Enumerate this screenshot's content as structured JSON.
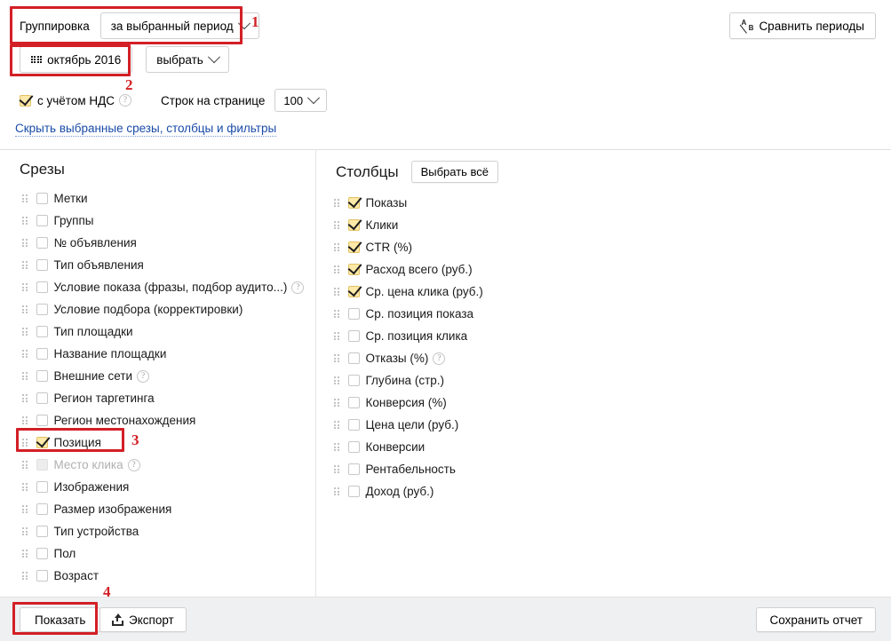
{
  "header": {
    "grouping_label": "Группировка",
    "grouping_value": "за выбранный период",
    "date_value": "октябрь 2016",
    "date_picker_label": "выбрать",
    "vat_label": "с учётом НДС",
    "vat_checked": true,
    "rows_per_page_label": "Строк на странице",
    "rows_per_page_value": "100",
    "toggle_link": "Скрыть выбранные срезы, столбцы и фильтры",
    "compare_periods_label": "Сравнить периоды",
    "compare_icon": "ab-test-icon",
    "calendar_icon": "calendar-icon"
  },
  "slices": {
    "title": "Срезы",
    "items": [
      {
        "label": "Метки",
        "checked": false,
        "disabled": false,
        "help": false
      },
      {
        "label": "Группы",
        "checked": false,
        "disabled": false,
        "help": false
      },
      {
        "label": "№ объявления",
        "checked": false,
        "disabled": false,
        "help": false
      },
      {
        "label": "Тип объявления",
        "checked": false,
        "disabled": false,
        "help": false
      },
      {
        "label": "Условие показа (фразы, подбор аудито...)",
        "checked": false,
        "disabled": false,
        "help": true
      },
      {
        "label": "Условие подбора (корректировки)",
        "checked": false,
        "disabled": false,
        "help": false
      },
      {
        "label": "Тип площадки",
        "checked": false,
        "disabled": false,
        "help": false
      },
      {
        "label": "Название площадки",
        "checked": false,
        "disabled": false,
        "help": false
      },
      {
        "label": "Внешние сети",
        "checked": false,
        "disabled": false,
        "help": true
      },
      {
        "label": "Регион таргетинга",
        "checked": false,
        "disabled": false,
        "help": false
      },
      {
        "label": "Регион местонахождения",
        "checked": false,
        "disabled": false,
        "help": false
      },
      {
        "label": "Позиция",
        "checked": true,
        "disabled": false,
        "help": false
      },
      {
        "label": "Место клика",
        "checked": false,
        "disabled": true,
        "help": true
      },
      {
        "label": "Изображения",
        "checked": false,
        "disabled": false,
        "help": false
      },
      {
        "label": "Размер изображения",
        "checked": false,
        "disabled": false,
        "help": false
      },
      {
        "label": "Тип устройства",
        "checked": false,
        "disabled": false,
        "help": false
      },
      {
        "label": "Пол",
        "checked": false,
        "disabled": false,
        "help": false
      },
      {
        "label": "Возраст",
        "checked": false,
        "disabled": false,
        "help": false
      }
    ]
  },
  "columns": {
    "title": "Столбцы",
    "select_all_label": "Выбрать всё",
    "items": [
      {
        "label": "Показы",
        "checked": true,
        "disabled": false,
        "help": false
      },
      {
        "label": "Клики",
        "checked": true,
        "disabled": false,
        "help": false
      },
      {
        "label": "CTR (%)",
        "checked": true,
        "disabled": false,
        "help": false
      },
      {
        "label": "Расход всего (руб.)",
        "checked": true,
        "disabled": false,
        "help": false
      },
      {
        "label": "Ср. цена клика (руб.)",
        "checked": true,
        "disabled": false,
        "help": false
      },
      {
        "label": "Ср. позиция показа",
        "checked": false,
        "disabled": false,
        "help": false
      },
      {
        "label": "Ср. позиция клика",
        "checked": false,
        "disabled": false,
        "help": false
      },
      {
        "label": "Отказы (%)",
        "checked": false,
        "disabled": false,
        "help": true
      },
      {
        "label": "Глубина (стр.)",
        "checked": false,
        "disabled": false,
        "help": false
      },
      {
        "label": "Конверсия (%)",
        "checked": false,
        "disabled": false,
        "help": false
      },
      {
        "label": "Цена цели (руб.)",
        "checked": false,
        "disabled": false,
        "help": false
      },
      {
        "label": "Конверсии",
        "checked": false,
        "disabled": false,
        "help": false
      },
      {
        "label": "Рентабельность",
        "checked": false,
        "disabled": false,
        "help": false
      },
      {
        "label": "Доход (руб.)",
        "checked": false,
        "disabled": false,
        "help": false
      }
    ]
  },
  "footer": {
    "show_label": "Показать",
    "export_label": "Экспорт",
    "export_icon": "export-upload-icon",
    "save_report_label": "Сохранить отчет"
  },
  "annotations": {
    "accent_color": "#d31f26",
    "markers": [
      {
        "number": "1",
        "target": "grouping-row"
      },
      {
        "number": "2",
        "target": "date-button"
      },
      {
        "number": "3",
        "target": "slice-position"
      },
      {
        "number": "4",
        "target": "show-button"
      }
    ]
  }
}
